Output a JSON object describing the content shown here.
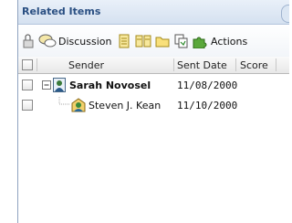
{
  "panel": {
    "title": "Related Items"
  },
  "toolbar": {
    "discussion_label": "Discussion",
    "actions_label": "Actions",
    "icons": [
      "attachment-icon",
      "discussion-icon",
      "note-icon",
      "grid-icon",
      "folder-icon",
      "copy-icon",
      "puzzle-icon"
    ]
  },
  "table": {
    "columns": [
      "Sender",
      "Sent Date",
      "Score"
    ],
    "rows": [
      {
        "sender": "Sarah Novosel",
        "sent_date": "11/08/2000",
        "score": "",
        "level": 0
      },
      {
        "sender": "Steven J. Kean",
        "sent_date": "11/10/2000",
        "score": "",
        "level": 1
      }
    ]
  },
  "colors": {
    "title": "#2a4f82",
    "accent": "#4a7a2a",
    "header_bg": "#e8e8e8"
  }
}
